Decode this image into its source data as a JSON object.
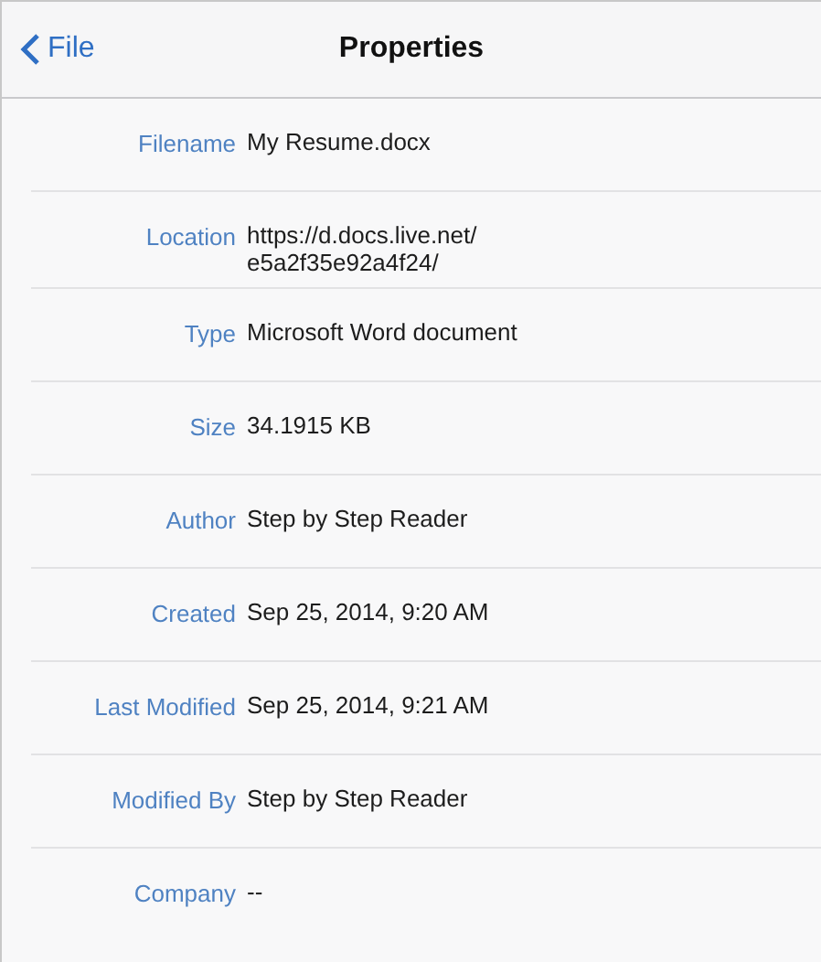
{
  "nav_bar": {
    "back_label": "File",
    "title": "Properties"
  },
  "properties": [
    {
      "label": "Filename",
      "value": "My Resume.docx"
    },
    {
      "label": "Location",
      "value": "https://d.docs.live.net/\ne5a2f35e92a4f24/"
    },
    {
      "label": "Type",
      "value": "Microsoft Word document"
    },
    {
      "label": "Size",
      "value": "34.1915 KB"
    },
    {
      "label": "Author",
      "value": "Step by Step Reader"
    },
    {
      "label": "Created",
      "value": "Sep 25, 2014, 9:20 AM"
    },
    {
      "label": "Last Modified",
      "value": "Sep 25, 2014, 9:21 AM"
    },
    {
      "label": "Modified By",
      "value": "Step by Step Reader"
    },
    {
      "label": "Company",
      "value": "--"
    }
  ]
}
